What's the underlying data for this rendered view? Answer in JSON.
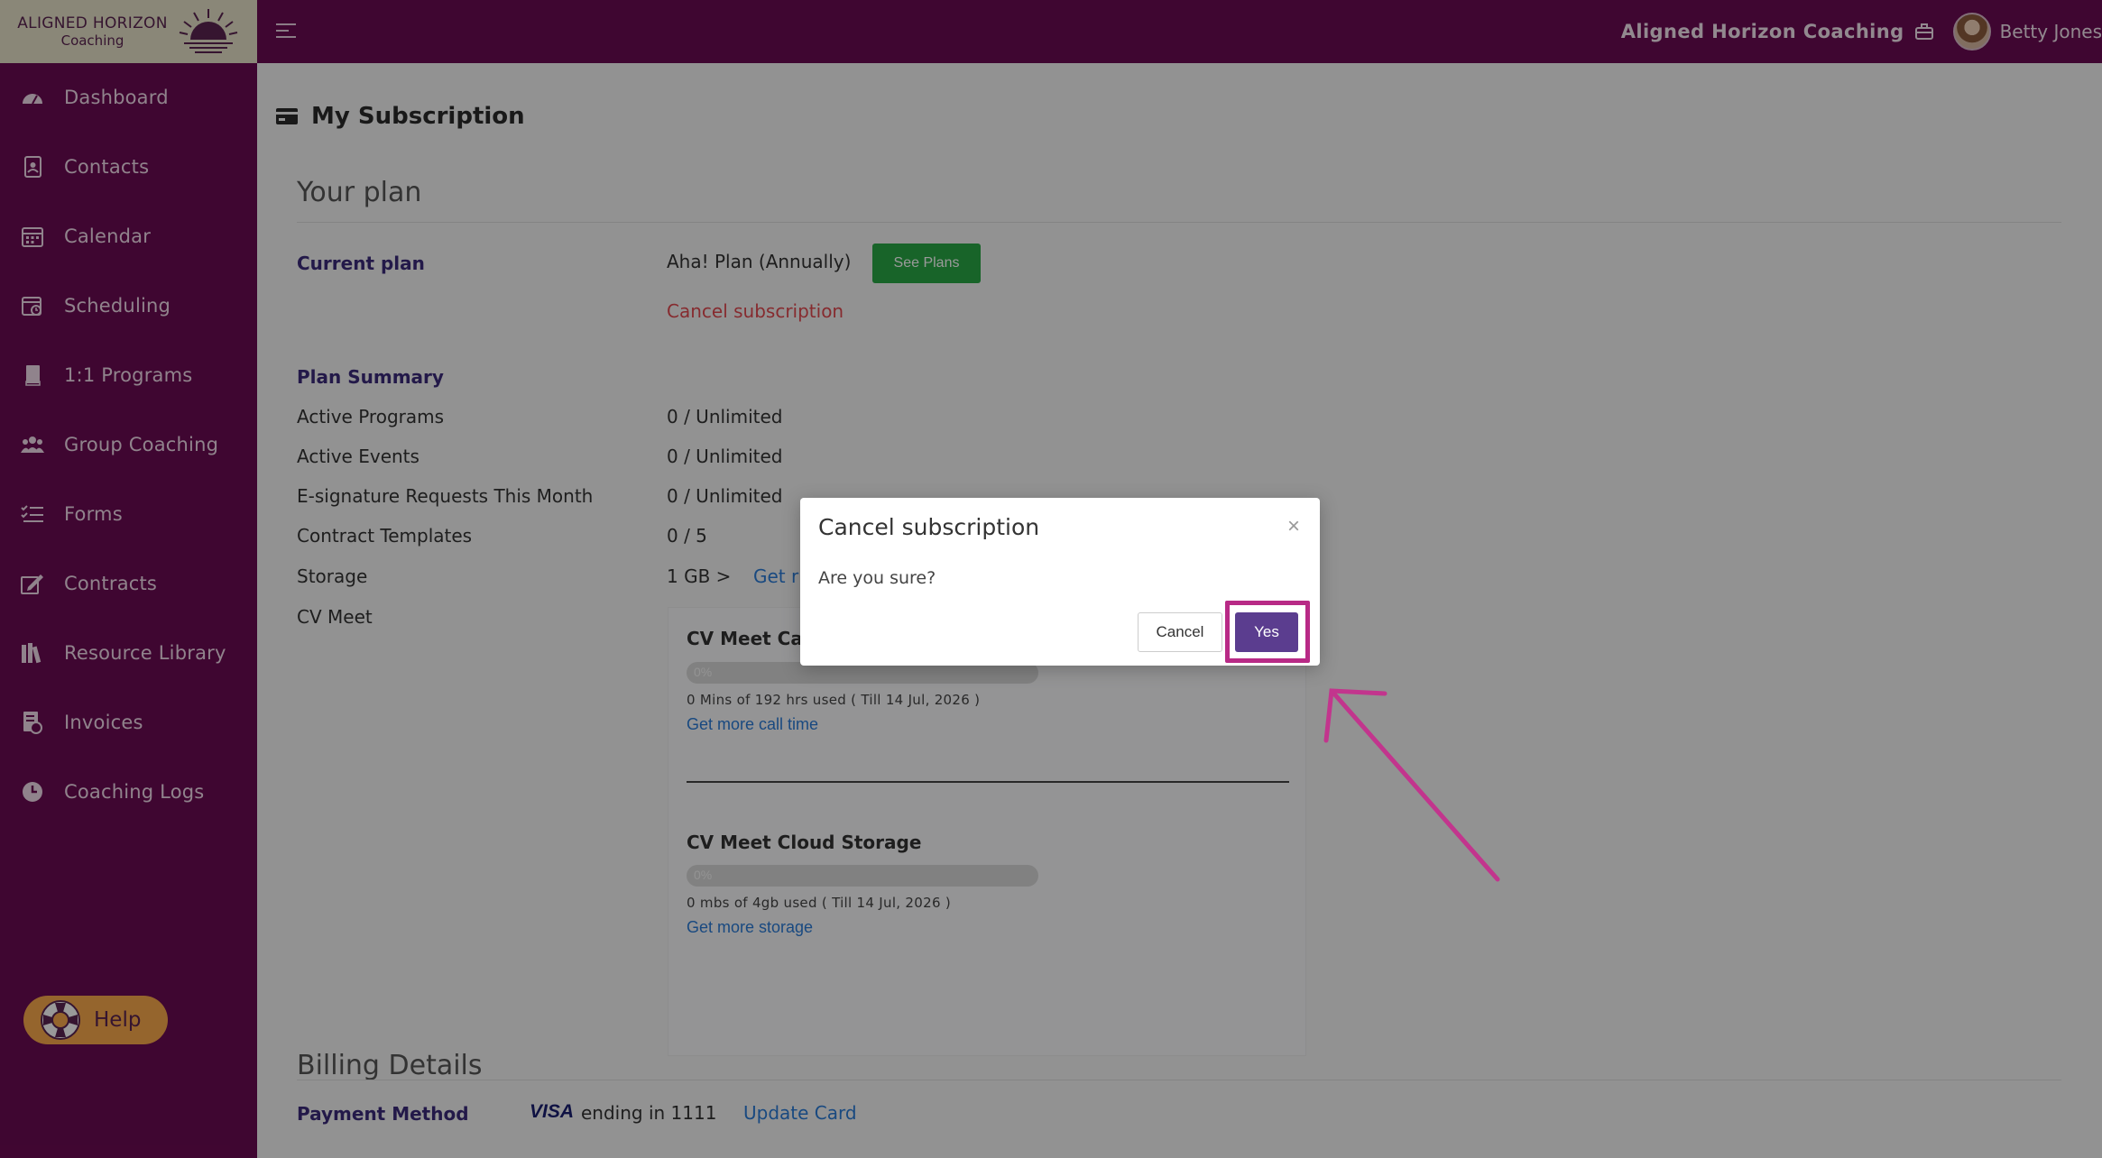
{
  "header": {
    "logo_line1": "ALIGNED HORIZON",
    "logo_line2": "Coaching",
    "org_name": "Aligned Horizon Coaching",
    "user_name": "Betty Jones"
  },
  "sidebar": {
    "items": [
      {
        "label": "Dashboard",
        "icon": "dashboard-gauge-icon"
      },
      {
        "label": "Contacts",
        "icon": "contacts-card-icon"
      },
      {
        "label": "Calendar",
        "icon": "calendar-icon"
      },
      {
        "label": "Scheduling",
        "icon": "scheduling-icon"
      },
      {
        "label": "1:1 Programs",
        "icon": "book-icon"
      },
      {
        "label": "Group Coaching",
        "icon": "group-users-icon"
      },
      {
        "label": "Forms",
        "icon": "checklist-icon"
      },
      {
        "label": "Contracts",
        "icon": "contract-sign-icon"
      },
      {
        "label": "Resource Library",
        "icon": "library-icon"
      },
      {
        "label": "Invoices",
        "icon": "invoice-icon"
      },
      {
        "label": "Coaching Logs",
        "icon": "clock-icon"
      }
    ],
    "help_label": "Help"
  },
  "page": {
    "title": "My Subscription",
    "your_plan": "Your plan",
    "current_plan_label": "Current plan",
    "current_plan_value": "Aha! Plan (Annually)",
    "see_plans": "See Plans",
    "cancel_subscription_link": "Cancel subscription",
    "plan_summary": "Plan Summary",
    "rows": [
      {
        "label": "Active Programs",
        "value": "0 / Unlimited"
      },
      {
        "label": "Active Events",
        "value": "0 / Unlimited"
      },
      {
        "label": "E-signature Requests This Month",
        "value": "0 / Unlimited"
      },
      {
        "label": "Contract Templates",
        "value": "0 / 5"
      },
      {
        "label": "Storage",
        "value": "1 GB >",
        "link": "Get r"
      },
      {
        "label": "CV Meet",
        "value": ""
      }
    ],
    "cv_call": {
      "title": "CV Meet Cal",
      "percent": "0%",
      "progress": 0,
      "usage": "0 Mins of 192 hrs used ( Till 14 Jul, 2026 )",
      "link": "Get more call time"
    },
    "cv_storage": {
      "title": "CV Meet Cloud Storage",
      "percent": "0%",
      "progress": 0,
      "usage": "0 mbs of 4gb used ( Till 14 Jul, 2026 )",
      "link": "Get more storage"
    },
    "billing_details": "Billing Details",
    "payment_method_label": "Payment Method",
    "card_brand": "VISA",
    "card_text": "ending in 1111",
    "update_card": "Update Card"
  },
  "modal": {
    "title": "Cancel subscription",
    "close": "×",
    "body": "Are you sure?",
    "cancel_label": "Cancel",
    "yes_label": "Yes"
  },
  "colors": {
    "brand_purple": "#6a0a52",
    "yes_button": "#5b3d8f",
    "see_plans": "#28a745",
    "annotation": "#b82a86"
  }
}
